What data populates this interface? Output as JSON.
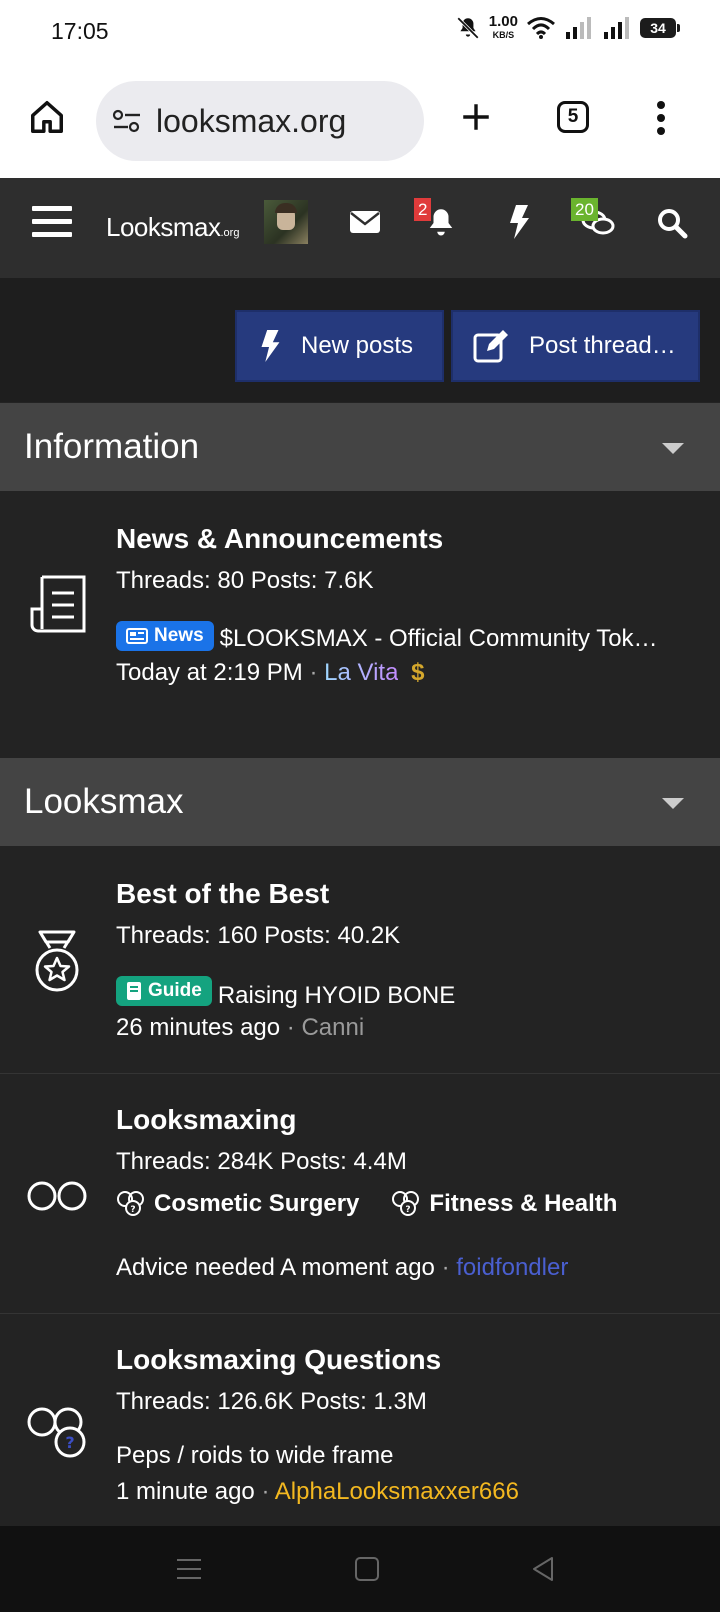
{
  "status_bar": {
    "time": "17:05",
    "net_speed_value": "1.00",
    "net_speed_unit": "KB/S",
    "battery": "34"
  },
  "browser": {
    "url": "looksmax.org",
    "tab_count": "5"
  },
  "site_header": {
    "logo_main": "Looksmax",
    "logo_suffix": ".org",
    "alerts_count": "2",
    "conversations_count": "20"
  },
  "actions": {
    "new_posts_label": "New posts",
    "post_thread_label": "Post thread…"
  },
  "sections": [
    {
      "title": "Information",
      "forums": [
        {
          "title": "News & Announcements",
          "stats": "Threads: 80 Posts: 7.6K",
          "prefix": "News",
          "latest_title": "$LOOKSMAX - Official Community Tok…",
          "latest_time": "Today at 2:19 PM",
          "latest_user": "La Vita",
          "user_emblem": "$"
        }
      ]
    },
    {
      "title": "Looksmax",
      "forums": [
        {
          "title": "Best of the Best",
          "stats": "Threads: 160 Posts: 40.2K",
          "prefix": "Guide",
          "latest_title": "Raising HYOID BONE",
          "latest_time": "26 minutes ago",
          "latest_user": "Canni"
        },
        {
          "title": "Looksmaxing",
          "stats": "Threads: 284K Posts: 4.4M",
          "subforums": [
            "Cosmetic Surgery",
            "Fitness & Health"
          ],
          "latest_title": "Advice needed",
          "latest_time": "A moment ago",
          "latest_user": "foidfondler"
        },
        {
          "title": "Looksmaxing Questions",
          "stats": "Threads: 126.6K Posts: 1.3M",
          "latest_title": "Peps / roids to wide frame",
          "latest_time": "1 minute ago",
          "latest_user": "AlphaLooksmaxxer666"
        }
      ]
    }
  ],
  "colors": {
    "news_prefix": "#1a73e8",
    "guide_prefix": "#14a37f",
    "user_lavita": "#b88cff",
    "user_canni": "#9a9a9a",
    "user_foidfondler": "#4a5fd0",
    "user_alpha": "#f3b820",
    "button_bg": "#263a7e"
  }
}
